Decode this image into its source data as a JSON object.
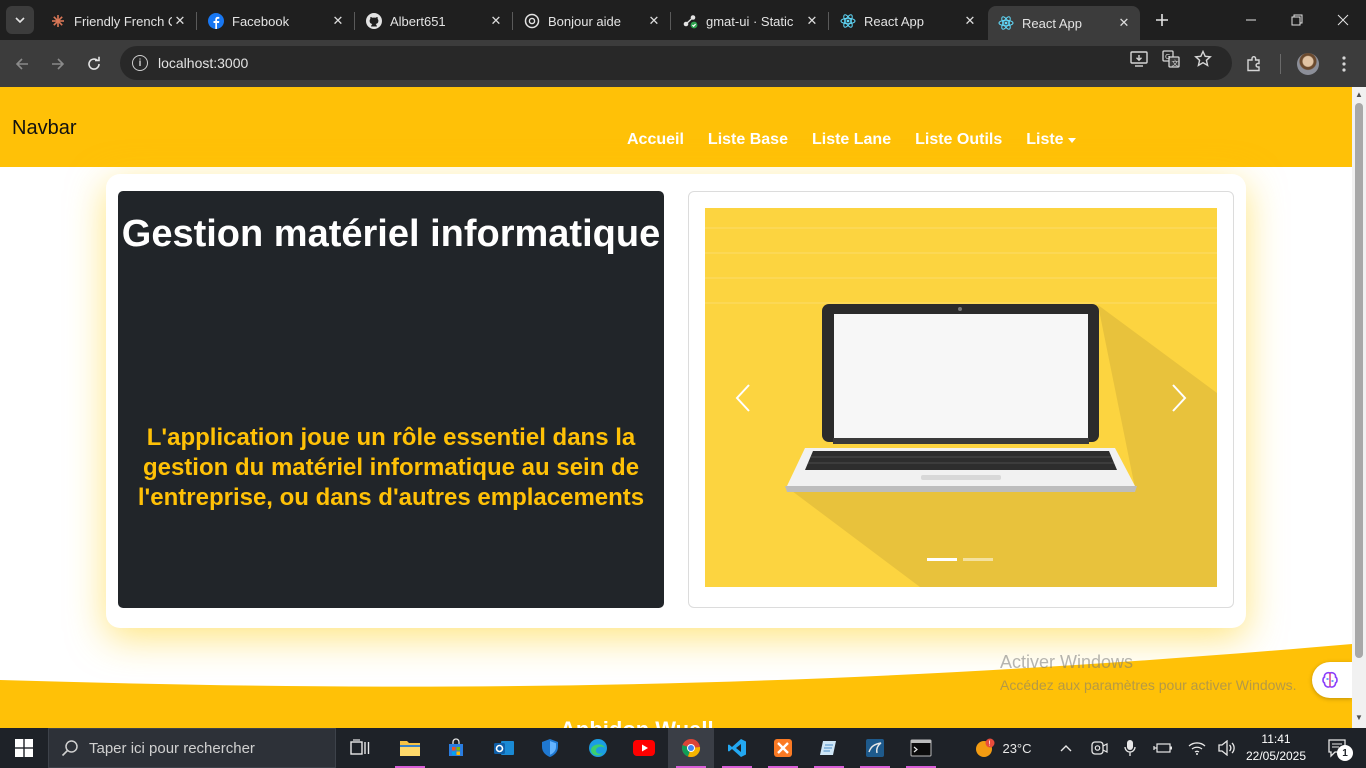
{
  "browser": {
    "tabs": [
      {
        "title": "Friendly French C",
        "icon": "claude-icon",
        "active": false
      },
      {
        "title": "Facebook",
        "icon": "facebook-icon",
        "active": false
      },
      {
        "title": "Albert651",
        "icon": "github-icon",
        "active": false
      },
      {
        "title": "Bonjour aide",
        "icon": "chatgpt-icon",
        "active": false
      },
      {
        "title": "gmat-ui · Static",
        "icon": "netlify-icon",
        "active": false
      },
      {
        "title": "React App",
        "icon": "react-icon",
        "active": false
      },
      {
        "title": "React App",
        "icon": "react-icon",
        "active": true
      }
    ],
    "close_glyph": "✕",
    "url": "localhost:3000"
  },
  "page": {
    "navbar": {
      "brand": "Navbar",
      "links": [
        "Accueil",
        "Liste Base",
        "Liste Lane",
        "Liste Outils",
        "Liste"
      ],
      "bg_color": "#ffc107"
    },
    "hero": {
      "title": "Gestion matériel informatique",
      "description": "L'application joue un rôle essentiel dans la gestion du matériel informatique au sein de l'entreprise, ou dans d'autres emplacements",
      "title_color": "#ffffff",
      "text_color": "#ffc107",
      "panel_color": "#212529"
    },
    "carousel": {
      "image": "laptop-illustration",
      "slide_count": 2,
      "active_slide": 1
    },
    "footer_partial": "Anbidon Wuall"
  },
  "watermark": {
    "line1": "Activer Windows",
    "line2": "Accédez aux paramètres pour activer Windows."
  },
  "taskbar": {
    "search_placeholder": "Taper ici pour rechercher",
    "apps": [
      "task-view",
      "file-explorer",
      "microsoft-store",
      "outlook",
      "windows-security",
      "edge",
      "youtube",
      "chrome",
      "vscode",
      "xampp",
      "notepad-app",
      "mysql-workbench",
      "terminal"
    ],
    "temperature": "23°C",
    "time": "11:41",
    "date": "22/05/2025",
    "notifications": "1"
  }
}
